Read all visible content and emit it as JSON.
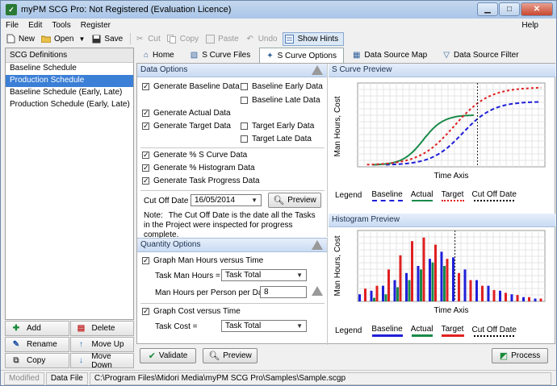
{
  "window": {
    "title": "myPM SCG Pro: Not Registered (Evaluation Licence)",
    "title_icon": "app-icon"
  },
  "menu": [
    "File",
    "Edit",
    "Tools",
    "Register"
  ],
  "menu_help": "Help",
  "toolbar": {
    "new": "New",
    "open": "Open",
    "save": "Save",
    "cut": "Cut",
    "copy": "Copy",
    "paste": "Paste",
    "undo": "Undo",
    "show_hints": "Show Hints"
  },
  "scg": {
    "header": "SCG Definitions",
    "items": [
      "Baseline Schedule",
      "Production Schedule",
      "Baseline Schedule (Early, Late)",
      "Production Schedule (Early, Late)"
    ],
    "selected_index": 1
  },
  "list_buttons": {
    "add": "Add",
    "delete": "Delete",
    "rename": "Rename",
    "move_up": "Move Up",
    "copy": "Copy",
    "move_down": "Move Down"
  },
  "tabs": [
    "Home",
    "S Curve Files",
    "S Curve Options",
    "Data Source Map",
    "Data Source Filter"
  ],
  "active_tab": 2,
  "data_options": {
    "header": "Data Options",
    "gen_baseline": "Generate Baseline Data",
    "baseline_early": "Baseline Early Data",
    "baseline_late": "Baseline Late Data",
    "gen_actual": "Generate Actual Data",
    "gen_target": "Generate Target Data",
    "target_early": "Target Early Data",
    "target_late": "Target Late Data",
    "gen_pct_scurve": "Generate % S Curve Data",
    "gen_pct_histogram": "Generate % Histogram Data",
    "gen_task_progress": "Generate Task Progress Data",
    "cutoff_label": "Cut Off Date",
    "cutoff_value": "16/05/2014",
    "preview_btn": "Preview",
    "note_label": "Note:",
    "note_text": "The Cut Off Date is the date all the Tasks in the Project were inspected for progress complete."
  },
  "quantity_options": {
    "header": "Quantity Options",
    "graph_man_hours": "Graph Man Hours versus Time",
    "task_man_hours_label": "Task Man Hours =",
    "task_man_hours_value": "Task Total",
    "man_hours_per_day_label": "Man Hours per Person per Day",
    "man_hours_per_day_value": "8",
    "graph_cost": "Graph Cost versus Time",
    "task_cost_label": "Task Cost =",
    "task_cost_value": "Task Total"
  },
  "scurve_preview": {
    "header": "S Curve Preview",
    "ylabel": "Man Hours, Cost",
    "xlabel": "Time Axis",
    "legend_title": "Legend",
    "legend": [
      "Baseline",
      "Actual",
      "Target",
      "Cut Off Date"
    ]
  },
  "histogram_preview": {
    "header": "Histogram Preview",
    "ylabel": "Man Hours, Cost",
    "xlabel": "Time Axis",
    "legend_title": "Legend",
    "legend": [
      "Baseline",
      "Actual",
      "Target",
      "Cut Off Date"
    ]
  },
  "colors": {
    "baseline": "#1f1fd8",
    "actual": "#1a8a4a",
    "target": "#e02020",
    "cutoff": "#000000"
  },
  "bottom": {
    "validate": "Validate",
    "preview": "Preview",
    "process": "Process"
  },
  "status": {
    "modified": "Modified",
    "data_file_label": "Data File",
    "data_file_path": "C:\\Program Files\\Midori Media\\myPM SCG Pro\\Samples\\Sample.scgp"
  }
}
